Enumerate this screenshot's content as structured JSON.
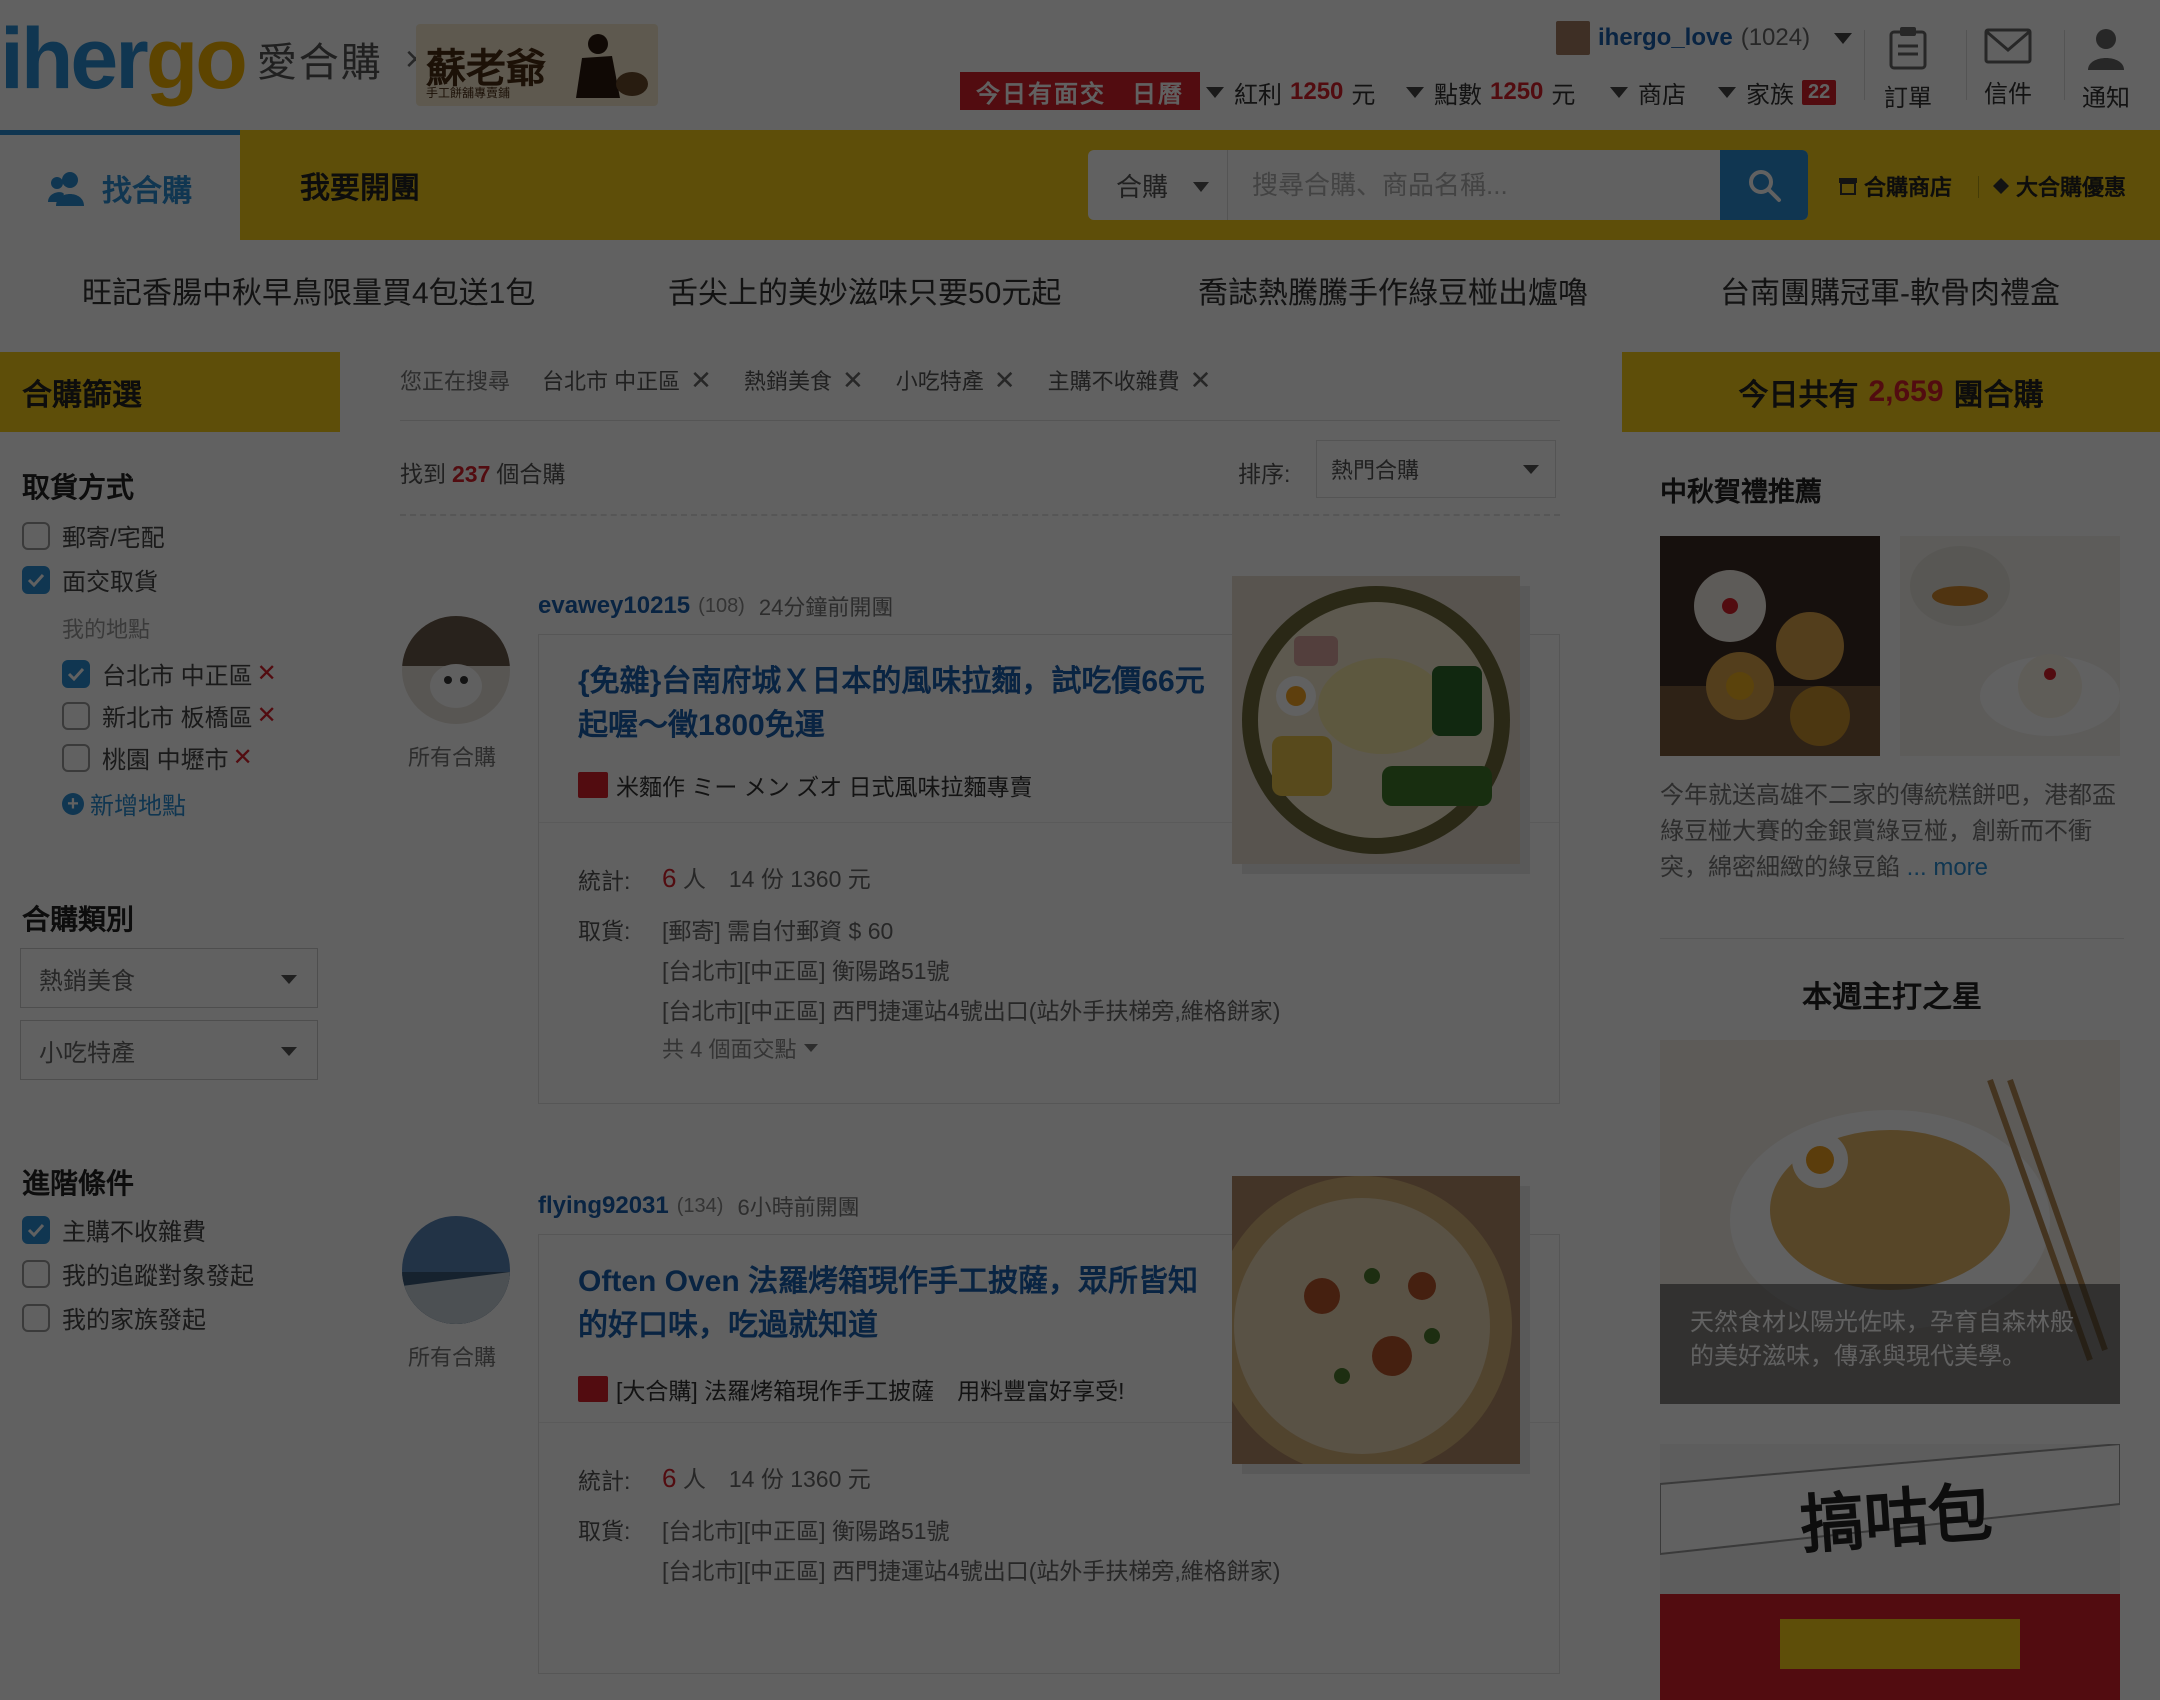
{
  "header": {
    "logo": {
      "brand": "ihergo",
      "brand_i": "iher",
      "brand_go": "go",
      "cn": "愛合購",
      "x": "×"
    },
    "partner": {
      "name": "蘇老爺",
      "sub": "手工餅舖專賣鋪"
    },
    "user": {
      "name": "ihergo_love",
      "count": "(1024)"
    },
    "today_badge": "今日有面交　日曆",
    "stats": {
      "bonus": {
        "label": "紅利",
        "value": "1250",
        "unit": "元"
      },
      "points": {
        "label": "點數",
        "value": "1250",
        "unit": "元"
      },
      "shop": {
        "label": "商店"
      },
      "family": {
        "label": "家族",
        "badge": "22"
      }
    },
    "icons": {
      "orders": "訂單",
      "mail": "信件",
      "notify": "通知"
    }
  },
  "nav": {
    "tab_find": "找合購",
    "tab_open": "我要開團",
    "search": {
      "select": "合購",
      "placeholder": "搜尋合購、商品名稱..."
    },
    "links": {
      "stores": "合購商店",
      "deals": "大合購優惠"
    }
  },
  "promo": [
    "旺記香腸中秋早鳥限量買4包送1包",
    "舌尖上的美妙滋味只要50元起",
    "喬誌熱騰騰手作綠豆椪出爐嚕",
    "台南團購冠軍-軟骨肉禮盒"
  ],
  "sidebar": {
    "title": "合購篩選",
    "pickup": {
      "title": "取貨方式",
      "mail": "郵寄/宅配",
      "face": "面交取貨",
      "my_places": "我的地點",
      "places": [
        "台北市 中正區",
        "新北市 板橋區",
        "桃園 中壢市"
      ],
      "add": "新增地點"
    },
    "category": {
      "title": "合購類別",
      "select1": "熱銷美食",
      "select2": "小吃特產"
    },
    "advanced": {
      "title": "進階條件",
      "items": [
        "主購不收雜費",
        "我的追蹤對象發起",
        "我的家族發起"
      ]
    }
  },
  "results": {
    "searching_label": "您正在搜尋",
    "chips": [
      "台北市 中正區",
      "熱銷美食",
      "小吃特產",
      "主購不收雜費"
    ],
    "found_prefix": "找到",
    "found_count": "237",
    "found_suffix": "個合購",
    "sort_label": "排序:",
    "sort_value": "熱門合購"
  },
  "cards": [
    {
      "user": "evawey10215",
      "count": "(108)",
      "time": "24分鐘前開團",
      "all_label": "所有合購",
      "title": "{免雜}台南府城Ｘ日本的風味拉麵，試吃價66元起喔～徵1800免運",
      "shop": "米麵作 ミー メン ズオ 日式風味拉麵專賣",
      "stats_label": "統計:",
      "people": "6",
      "people_unit": "人",
      "stats_rest": "14 份 1360 元",
      "pickup_label": "取貨:",
      "pickups": [
        "[郵寄] 需自付郵資 $ 60",
        "[台北市][中正區] 衡陽路51號",
        "[台北市][中正區] 西門捷運站4號出口(站外手扶梯旁,維格餅家)"
      ],
      "more": "共 4 個面交點"
    },
    {
      "user": "flying92031",
      "count": "(134)",
      "time": "6小時前開團",
      "all_label": "所有合購",
      "title": "Often Oven 法羅烤箱現作手工披薩，眾所皆知的好口味，吃過就知道",
      "shop": "[大合購] 法羅烤箱現作手工披薩　用料豐富好享受!",
      "stats_label": "統計:",
      "people": "6",
      "people_unit": "人",
      "stats_rest": "14 份 1360 元",
      "pickup_label": "取貨:",
      "pickups": [
        "[台北市][中正區] 衡陽路51號",
        "[台北市][中正區] 西門捷運站4號出口(站外手扶梯旁,維格餅家)"
      ]
    }
  ],
  "right": {
    "head_prefix": "今日共有",
    "head_count": "2,659",
    "head_suffix": "團合購",
    "gift_title": "中秋賀禮推薦",
    "gift_desc": "今年就送高雄不二家的傳統糕餅吧，港都盃綠豆椪大賽的金銀賞綠豆椪，創新而不衝突，綿密細緻的綠豆餡",
    "gift_more": "... more",
    "star_title": "本週主打之星",
    "star_caption": "天然食材以陽光佐味，孕育自森林般的美好滋味，傳承與現代美學。",
    "shop_sign": "搞咕包"
  },
  "colors": {
    "accent_blue": "#2a8fd4",
    "brand_yellow": "#f6ce1a",
    "alert_red": "#d8202c"
  }
}
